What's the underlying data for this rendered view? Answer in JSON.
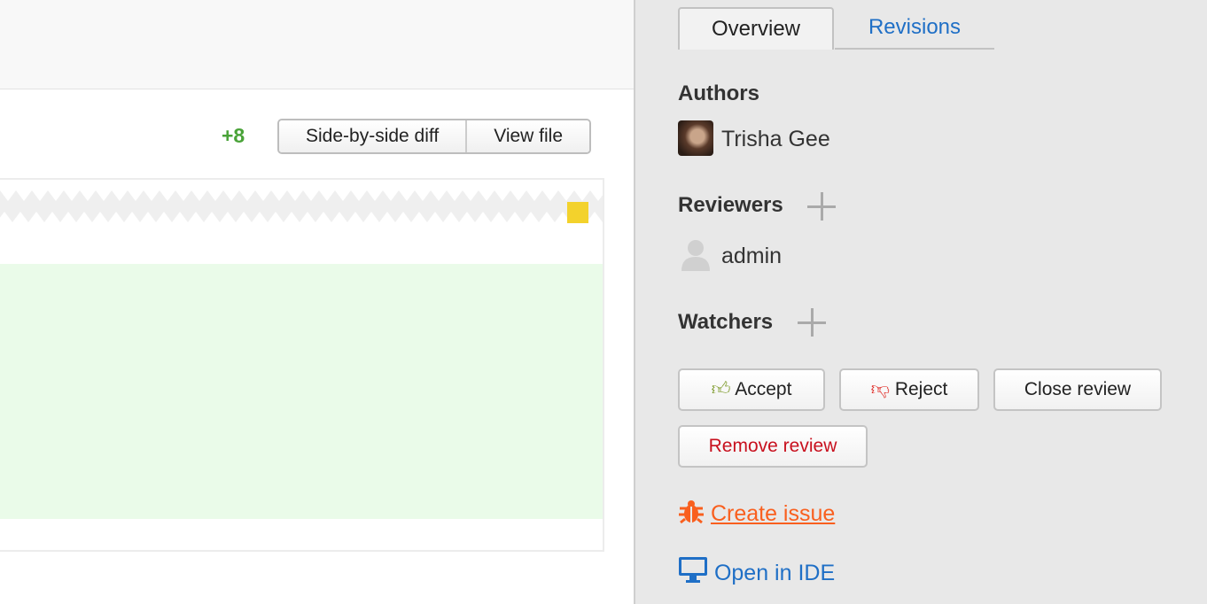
{
  "diff": {
    "added_count": "+8",
    "side_by_side_label": "Side-by-side diff",
    "view_file_label": "View file"
  },
  "sidebar": {
    "tabs": [
      {
        "label": "Overview",
        "active": true
      },
      {
        "label": "Revisions",
        "active": false
      }
    ],
    "authors_heading": "Authors",
    "authors": [
      {
        "name": "Trisha Gee",
        "icon": "avatar-photo"
      }
    ],
    "reviewers_heading": "Reviewers",
    "reviewers": [
      {
        "name": "admin",
        "icon": "default-user-icon"
      }
    ],
    "watchers_heading": "Watchers",
    "actions": {
      "accept": "Accept",
      "reject": "Reject",
      "close": "Close review",
      "remove": "Remove review"
    },
    "create_issue": "Create issue",
    "open_in_ide": "Open in IDE"
  },
  "colors": {
    "added": "#4aa339",
    "link": "#1f6fc6",
    "issue": "#f95f1e",
    "remove": "#c8101e",
    "accept_icon": "#7d9a2a",
    "reject_icon": "#e0302b"
  }
}
